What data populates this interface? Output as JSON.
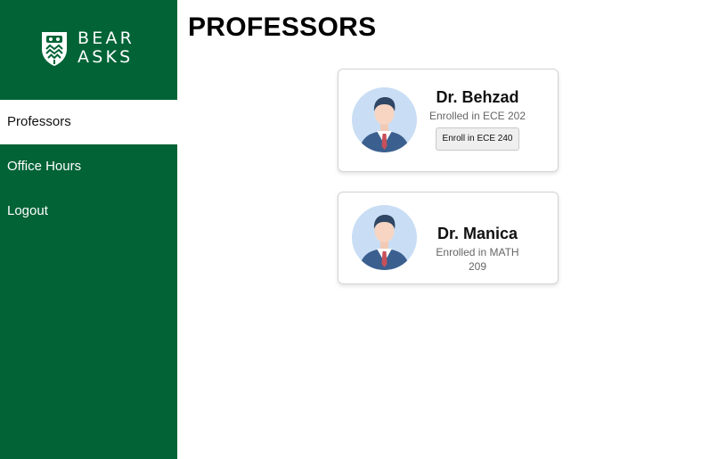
{
  "brand": {
    "line1": "BEAR",
    "line2": "ASKS",
    "icon": "shield-logo-icon",
    "color": "#016336"
  },
  "page": {
    "title": "PROFESSORS"
  },
  "sidebar": {
    "items": [
      {
        "label": "Professors",
        "active": true
      },
      {
        "label": "Office Hours",
        "active": false
      },
      {
        "label": "Logout",
        "active": false
      }
    ]
  },
  "professors": [
    {
      "name": "Dr. Behzad",
      "enrolled": "Enrolled in ECE 202",
      "action_label": "Enroll in ECE 240",
      "avatar_icon": "professor-avatar-icon"
    },
    {
      "name": "Dr. Manica",
      "enrolled": "Enrolled in MATH 209",
      "avatar_icon": "professor-avatar-icon"
    }
  ],
  "colors": {
    "sidebar": "#016336",
    "avatar_bg": "#c9def5",
    "suit": "#3b5f8f",
    "tie": "#c8505a"
  }
}
